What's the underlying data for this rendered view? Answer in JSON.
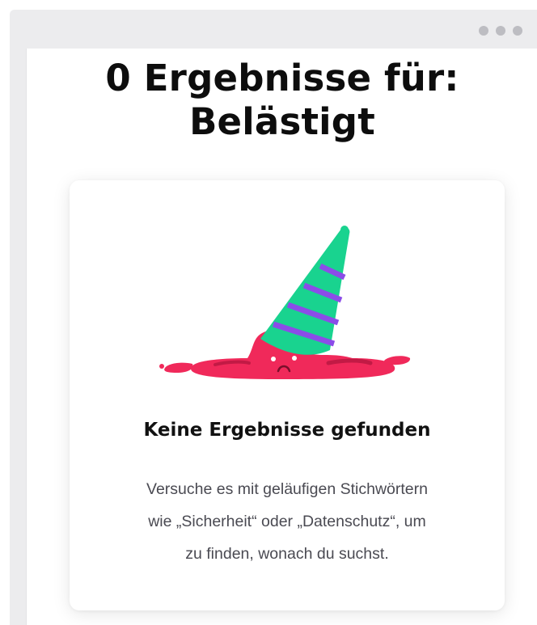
{
  "window": {
    "controls": [
      "dot",
      "dot",
      "dot"
    ]
  },
  "page": {
    "title_line1": "0 Ergebnisse für:",
    "title_line2": "Belästigt"
  },
  "empty_state": {
    "illustration": "melted-party-hat",
    "heading": "Keine Ergebnisse gefunden",
    "text_line1": "Versuche es mit geläufigen Stichwörtern",
    "text_line2": "wie „Sicherheit“ oder „Datenschutz“, um",
    "text_line3": "zu finden, wonach du suchst."
  },
  "colors": {
    "puddle": "#f0295a",
    "puddle_dark": "#c21a45",
    "hat": "#19d38f",
    "stripe": "#8b4ce8",
    "title": "#0d0d0d",
    "body_text": "#4a4a52"
  }
}
